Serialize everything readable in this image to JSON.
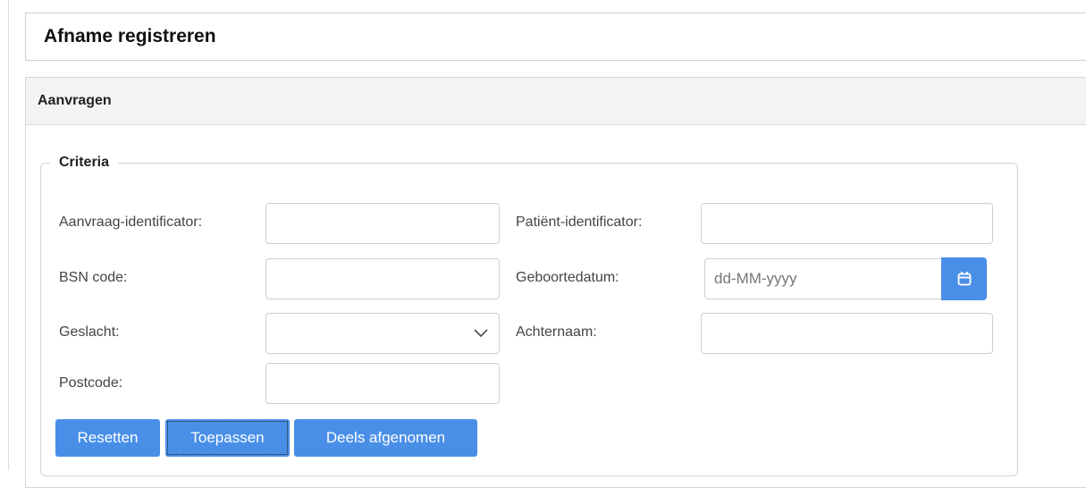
{
  "page": {
    "title": "Afname registreren"
  },
  "panel": {
    "title": "Aanvragen"
  },
  "criteria": {
    "legend": "Criteria",
    "fields": {
      "aanvraag_id": {
        "label": "Aanvraag-identificator:",
        "value": ""
      },
      "patient_id": {
        "label": "Patiënt-identificator:",
        "value": ""
      },
      "bsn": {
        "label": "BSN code:",
        "value": ""
      },
      "geboortedatum": {
        "label": "Geboortedatum:",
        "value": "",
        "placeholder": "dd-MM-yyyy"
      },
      "geslacht": {
        "label": "Geslacht:",
        "value": ""
      },
      "achternaam": {
        "label": "Achternaam:",
        "value": ""
      },
      "postcode": {
        "label": "Postcode:",
        "value": ""
      }
    }
  },
  "buttons": {
    "reset": "Resetten",
    "apply": "Toepassen",
    "partial": "Deels afgenomen"
  },
  "icons": {
    "calendar": "calendar-icon",
    "dropdown": "chevron-down-icon"
  },
  "colors": {
    "primary": "#4a8fe7",
    "panel_header": "#f2f3f5",
    "border": "#cfcfcf"
  }
}
